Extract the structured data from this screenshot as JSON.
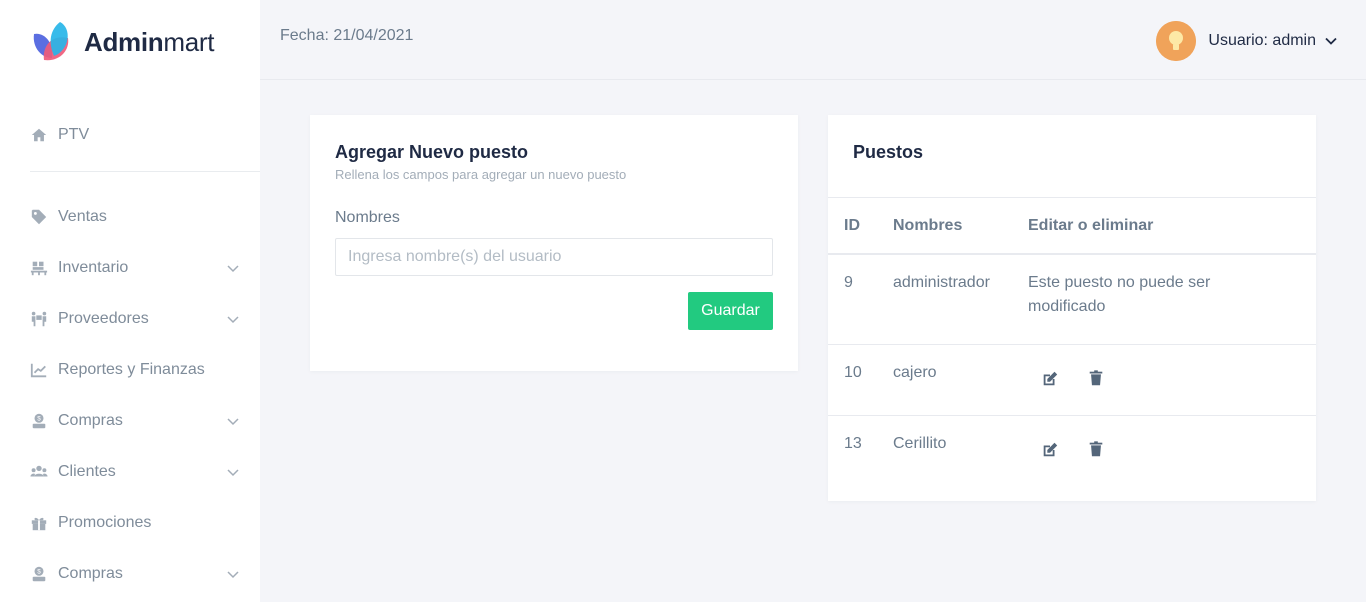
{
  "brand": {
    "bold": "Admin",
    "light": "mart"
  },
  "topbar": {
    "date": "Fecha: 21/04/2021",
    "user_label": "Usuario: admin"
  },
  "sidebar": {
    "items": [
      {
        "label": "PTV",
        "icon": "home-icon",
        "has_submenu": false
      },
      {
        "label": "Ventas",
        "icon": "tag-icon",
        "has_submenu": false
      },
      {
        "label": "Inventario",
        "icon": "pallet-icon",
        "has_submenu": true
      },
      {
        "label": "Proveedores",
        "icon": "people-carry-icon",
        "has_submenu": true
      },
      {
        "label": "Reportes y Finanzas",
        "icon": "chart-line-icon",
        "has_submenu": false
      },
      {
        "label": "Compras",
        "icon": "cash-register-icon",
        "has_submenu": true
      },
      {
        "label": "Clientes",
        "icon": "users-icon",
        "has_submenu": true
      },
      {
        "label": "Promociones",
        "icon": "gift-icon",
        "has_submenu": false
      },
      {
        "label": "Compras",
        "icon": "cash-register-icon",
        "has_submenu": true
      }
    ]
  },
  "add_form": {
    "title": "Agregar Nuevo puesto",
    "subtitle": "Rellena los campos para agregar un nuevo puesto",
    "field_label": "Nombres",
    "field_value": "",
    "field_placeholder": "Ingresa nombre(s) del usuario",
    "save_label": "Guardar"
  },
  "positions": {
    "title": "Puestos",
    "columns": [
      "ID",
      "Nombres",
      "Editar o eliminar"
    ],
    "rows": [
      {
        "id": "9",
        "name": "administrador",
        "note": "Este puesto no puede ser modificado"
      },
      {
        "id": "10",
        "name": "cajero"
      },
      {
        "id": "13",
        "name": "Cerillito"
      }
    ]
  },
  "colors": {
    "accent_green": "#22ca80",
    "text_dark": "#1f2a44",
    "text_muted": "#6b7b8c",
    "bg": "#f4f5f9"
  }
}
